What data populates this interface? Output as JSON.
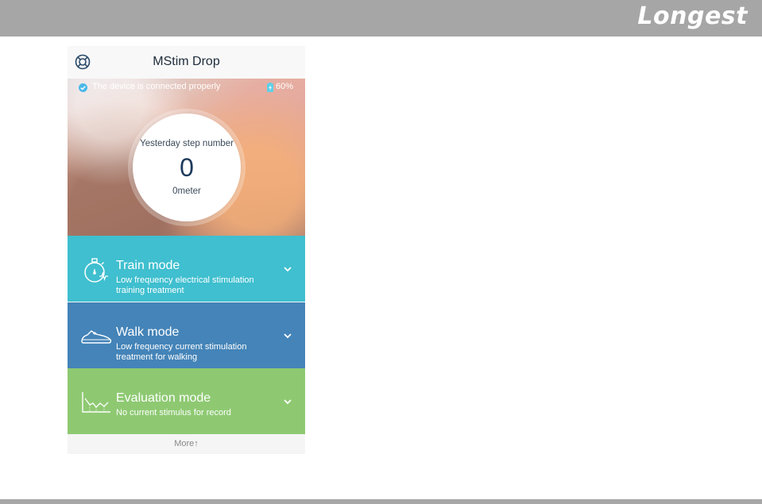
{
  "brand": {
    "name": "Longest"
  },
  "app": {
    "title": "MStim Drop",
    "help_icon": "lifebuoy-icon"
  },
  "status": {
    "connection_text": "The device is connected properly",
    "battery_text": "60%",
    "check_icon": "check-circle-icon",
    "battery_icon": "battery-charging-icon"
  },
  "steps": {
    "label": "Yesterday step number",
    "value": "0",
    "unit": "0meter"
  },
  "modes": [
    {
      "title": "Train mode",
      "description_line1": "Low frequency electrical stimulation",
      "description_line2": "training treatment",
      "icon": "stopwatch-icon",
      "color": "#3fbfcf"
    },
    {
      "title": "Walk mode",
      "description_line1": "Low frequency current stimulation",
      "description_line2": "treatment for walking",
      "icon": "shoe-icon",
      "color": "#4484b8"
    },
    {
      "title": "Evaluation mode",
      "description_line1": "No current stimulus for record",
      "description_line2": "",
      "icon": "chart-area-icon",
      "color": "#8ec972"
    }
  ],
  "footer": {
    "more_label": "More↑"
  }
}
